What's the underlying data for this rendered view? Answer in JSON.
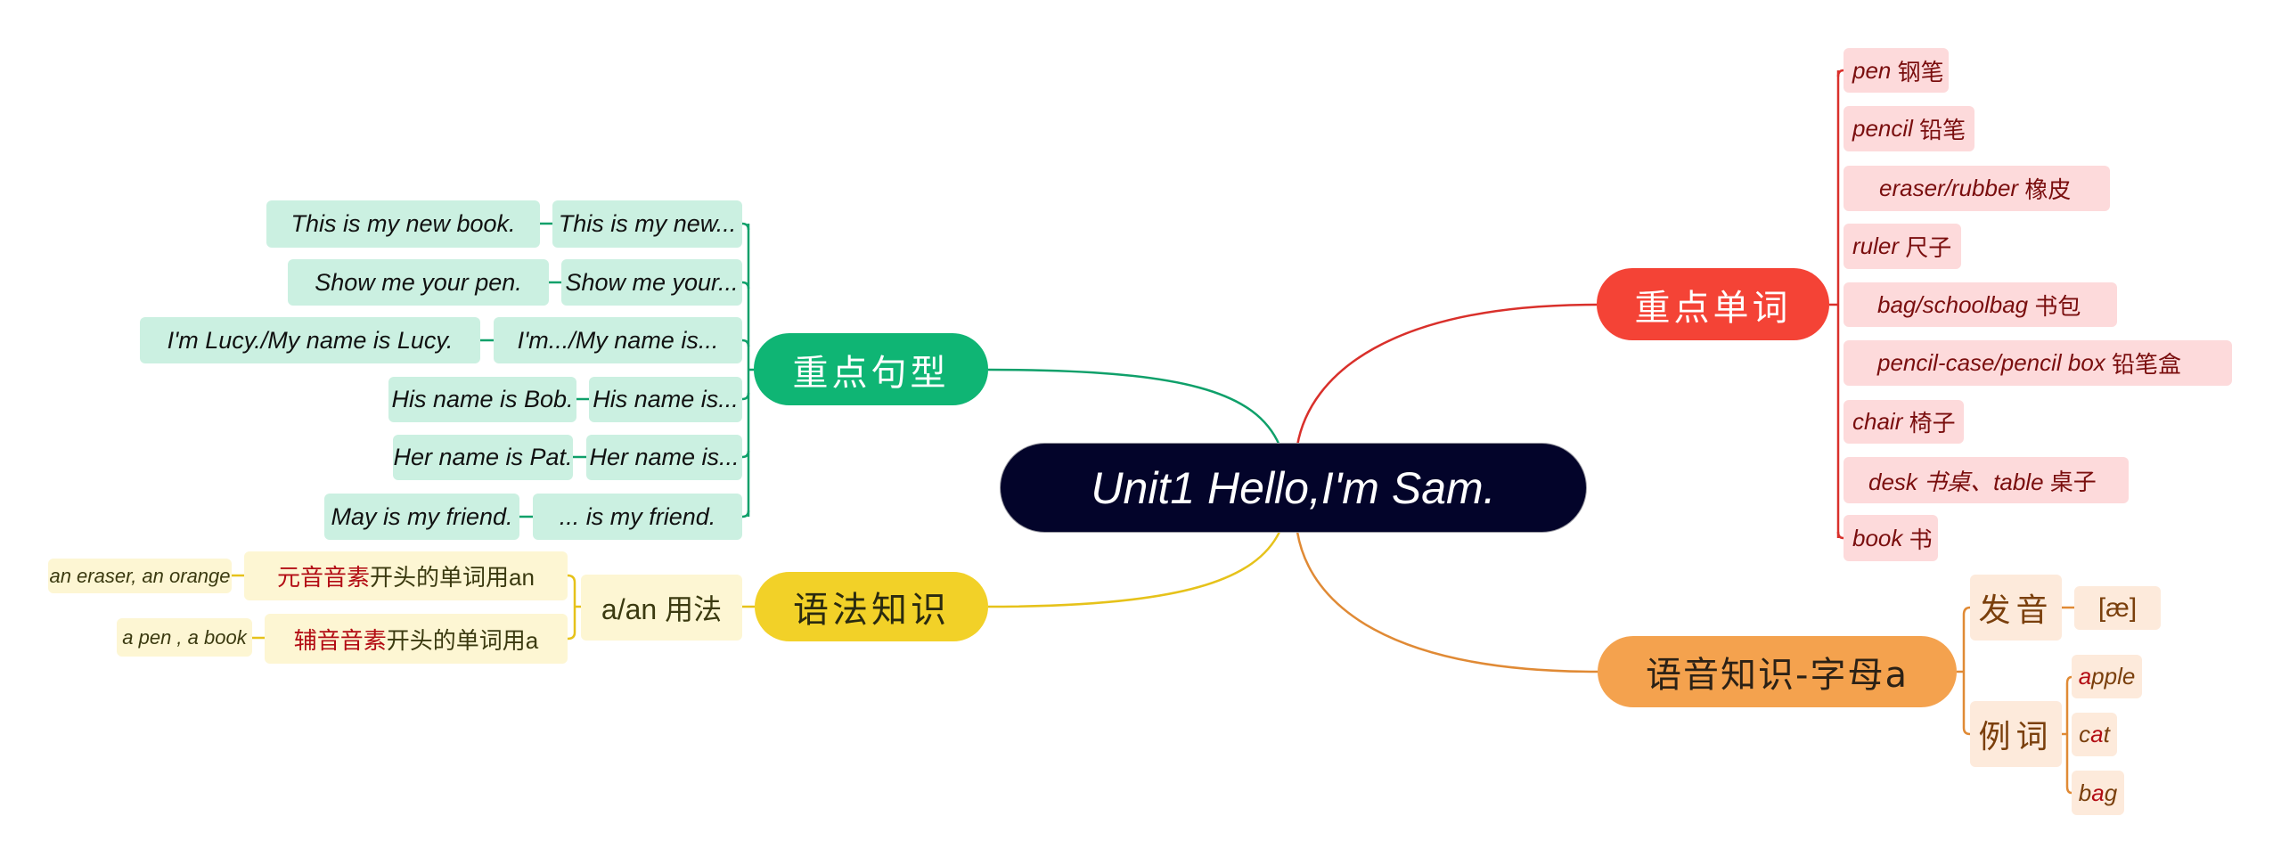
{
  "central": {
    "title": "Unit1 Hello,I'm Sam."
  },
  "branches": {
    "sentences": {
      "label": "重点句型",
      "color": "#0fb574",
      "rows": [
        {
          "pattern": "This is my new...",
          "example": "This is my new book."
        },
        {
          "pattern": "Show me your...",
          "example": "Show me your pen."
        },
        {
          "pattern": "I'm.../My name is...",
          "example": "I'm Lucy./My name is Lucy."
        },
        {
          "pattern": "His name is...",
          "example": "His name is Bob."
        },
        {
          "pattern": "Her name is...",
          "example": "Her name is Pat."
        },
        {
          "pattern": "... is my friend.",
          "example": "May is my friend."
        }
      ]
    },
    "grammar": {
      "label": "语法知识",
      "color": "#f2d128",
      "topic": "a/an 用法",
      "rules": [
        {
          "rule_highlight": "元音音素",
          "rule_rest": "开头的单词用an",
          "example": "an eraser, an orange"
        },
        {
          "rule_highlight": "辅音音素",
          "rule_rest": "开头的单词用a",
          "example": "a pen , a book"
        }
      ]
    },
    "words": {
      "label": "重点单词",
      "color": "#f44336",
      "items": [
        {
          "en": "pen",
          "cn": "钢笔"
        },
        {
          "en": "pencil",
          "cn": "铅笔"
        },
        {
          "en": "eraser/rubber",
          "cn": "橡皮"
        },
        {
          "en": "ruler",
          "cn": "尺子"
        },
        {
          "en": "bag/schoolbag",
          "cn": "书包"
        },
        {
          "en": "pencil-case/pencil box",
          "cn": "铅笔盒"
        },
        {
          "en": "chair",
          "cn": "椅子"
        },
        {
          "en": "desk 书桌、table",
          "cn": "桌子"
        },
        {
          "en": "book",
          "cn": "书"
        }
      ]
    },
    "phonics": {
      "label": "语音知识-字母a",
      "color": "#f4a24e",
      "pronunciation": {
        "label": "发音",
        "value": "[æ]"
      },
      "examples": {
        "label": "例词",
        "words": [
          {
            "pre": "",
            "hl": "a",
            "post": "pple"
          },
          {
            "pre": "c",
            "hl": "a",
            "post": "t"
          },
          {
            "pre": "b",
            "hl": "a",
            "post": "g"
          }
        ]
      }
    }
  }
}
